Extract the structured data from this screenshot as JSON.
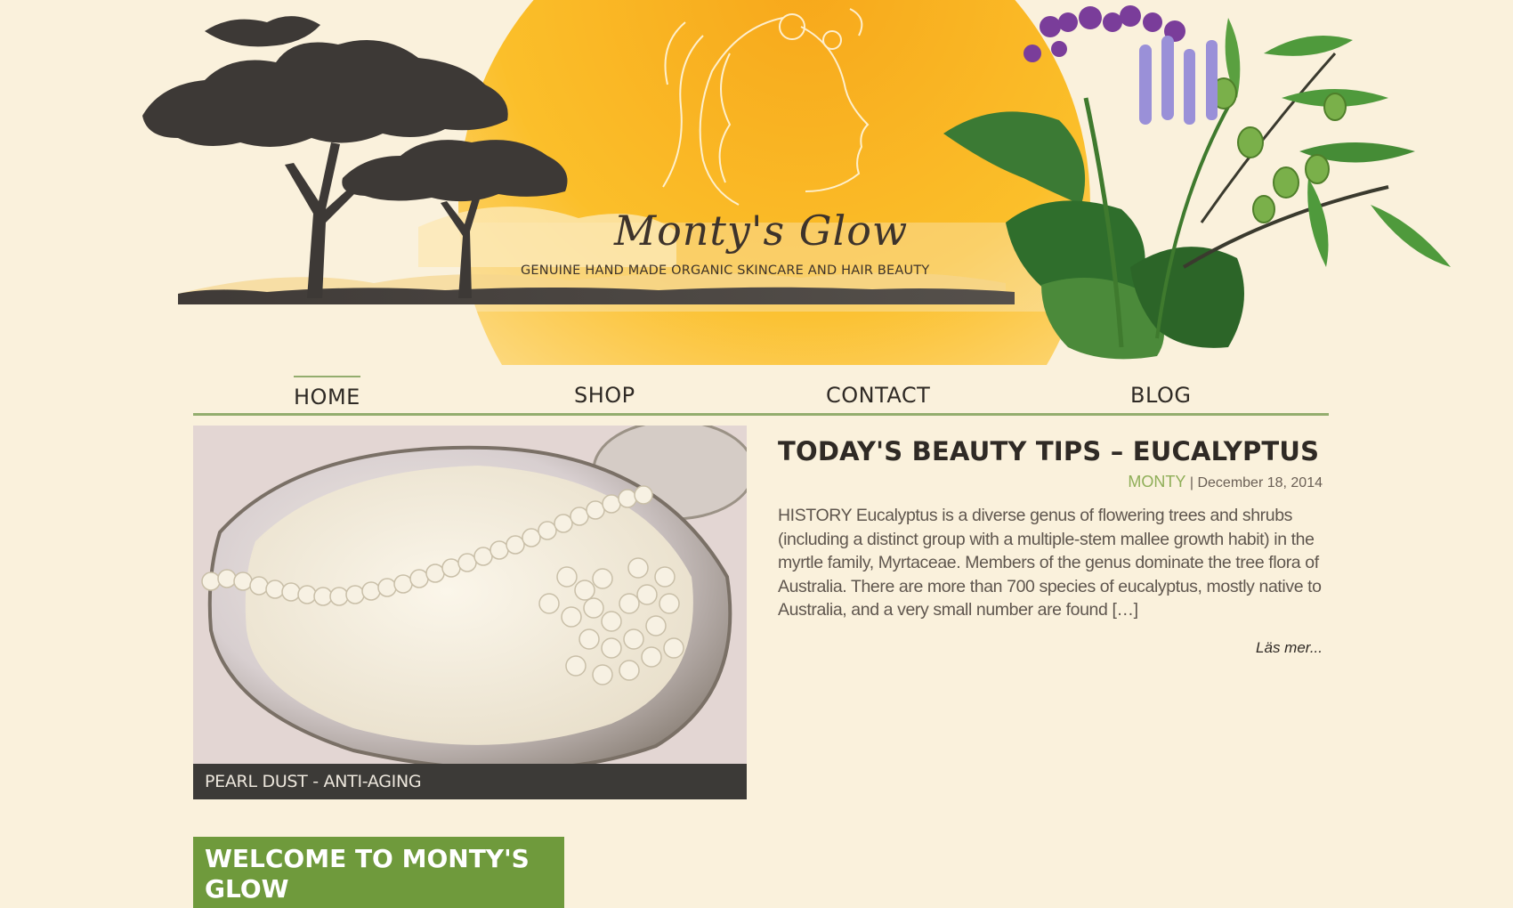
{
  "brand": {
    "name": "Monty's Glow",
    "tagline": "GENUINE HAND MADE ORGANIC SKINCARE AND HAIR BEAUTY"
  },
  "nav": {
    "items": [
      {
        "label": "HOME",
        "active": true
      },
      {
        "label": "SHOP",
        "active": false
      },
      {
        "label": "CONTACT",
        "active": false
      },
      {
        "label": "BLOG",
        "active": false
      }
    ]
  },
  "feature": {
    "caption": "PEARL DUST - ANTI-AGING"
  },
  "post": {
    "title": "TODAY'S BEAUTY TIPS – EUCALYPTUS",
    "author": "MONTY",
    "separator": "|",
    "date": "December 18, 2014",
    "excerpt": "HISTORY Eucalyptus is a diverse genus of flowering trees and shrubs (including a distinct group with a multiple-stem mallee growth habit) in the myrtle family, Myrtaceae. Members of the genus dominate the tree flora of Australia. There are more than 700 species of eucalyptus, mostly native to Australia, and a very small number are found […]",
    "read_more": "Läs mer..."
  },
  "welcome": {
    "title": "WELCOME TO MONTY'S GLOW"
  },
  "colors": {
    "background": "#faf1dc",
    "accent_green": "#93ad6e",
    "welcome_green": "#6f9a3c",
    "sun_orange": "#f7a81b"
  }
}
